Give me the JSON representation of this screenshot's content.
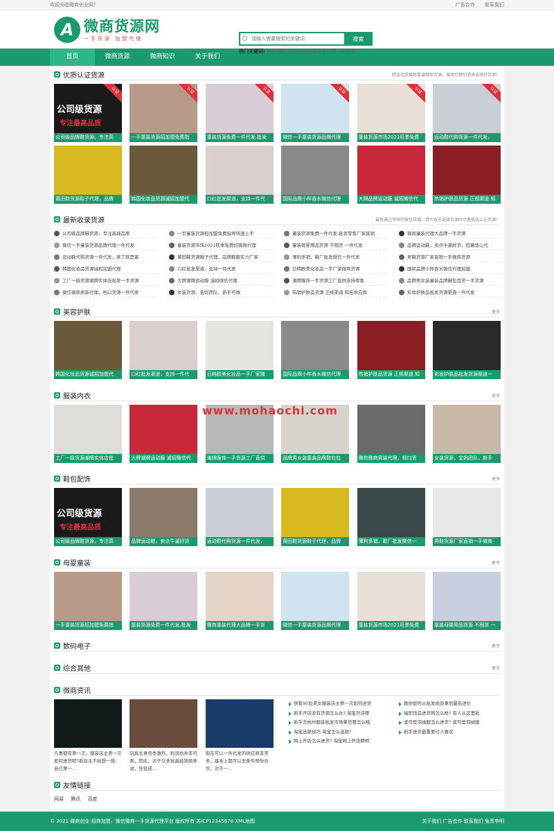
{
  "topbar": {
    "welcome": "欢迎光临微商创业网!",
    "ad": "广告合作",
    "contact": "联系我们"
  },
  "logo": {
    "mark": "A",
    "title": "微商货源网",
    "slogan": "一手货源 加盟代理"
  },
  "search": {
    "placeholder": "请输入需要搜索的关键词",
    "button": "搜索",
    "hot_label": "热门关键词:",
    "hot_words": "微商货源 淘宝网店免费微商代理一手货源"
  },
  "nav": [
    "首页",
    "微商货源",
    "微商知识",
    "关于我们"
  ],
  "watermark": "www.mohaochi.com",
  "sections": {
    "certified": {
      "title": "优质认证货源",
      "right": "精选优质推荐靠谱微商货源，微商代理们请来选择好货源！"
    },
    "latest": {
      "title": "最新收录货源",
      "right": "最新通过审核的微信货源，请大家在选择货源时尽量挑选认证货源！"
    },
    "beauty": {
      "title": "美容护肤",
      "right": "更多"
    },
    "clothes": {
      "title": "服装内衣",
      "right": "更多"
    },
    "shoes": {
      "title": "鞋包配饰",
      "right": "更多"
    },
    "baby": {
      "title": "母婴童装",
      "right": "更多"
    },
    "digital": {
      "title": "数码电子",
      "right": "更多"
    },
    "other": {
      "title": "综合其他",
      "right": "更多"
    },
    "news": {
      "title": "微商资讯"
    },
    "friends": {
      "title": "友情链接"
    }
  },
  "certified_cards": [
    {
      "cap": "公司级品牌鞋货源，专注高",
      "c": "#1a1a1a",
      "ribbon": "认证",
      "t1": "公司级货源",
      "t2": "专注最高品质"
    },
    {
      "cap": "一手童装货源招加盟免费指",
      "c": "#b89a8a",
      "ribbon": "认证"
    },
    {
      "cap": "童装货源免费一件代发,批发",
      "c": "#d8ccd6",
      "ribbon": "认证"
    },
    {
      "cap": "微信一手童装货源品牌代理",
      "c": "#cfe4ee",
      "ribbon": "认证"
    },
    {
      "cap": "童装货源市场2021旺季免费",
      "c": "#e8e0d6",
      "ribbon": "认证"
    },
    {
      "cap": "运动鞋代购货源一件代发，",
      "c": "#c9cfd4",
      "ribbon": "认证"
    },
    {
      "cap": "莆田鞋货源鞋子代理，品牌",
      "c": "#d9b920",
      "ribbon": ""
    },
    {
      "cap": "韩国化妆品货源诚招加盟代",
      "c": "#6b5a3a",
      "ribbon": ""
    },
    {
      "cap": "口红批发渠道，支持一件代",
      "c": "#d8d0cc",
      "ribbon": ""
    },
    {
      "cap": "国际品牌小样香水微信代理",
      "c": "#8a8a8a",
      "ribbon": ""
    },
    {
      "cap": "大牌品牌运动服 诚招微信代",
      "c": "#c8283a",
      "ribbon": ""
    },
    {
      "cap": "热销护肤品货源 正规渠道 知",
      "c": "#8a1e22",
      "ribbon": ""
    }
  ],
  "latest_list": [
    "公司级品牌鞋货源，专注高端品质",
    "一手童装货源招加盟免费指导快速上手",
    "童装货源免费一件代发,批发零售厂家直销",
    "微商童装代理大品牌一手货源",
    "微信一手童装货源品牌代理一件代发",
    "童装货源市场2021旺季免费招微商代理",
    "童装母婴用品货源 不囤货 一件代发",
    "品牌运动鞋，卖点牛逼好货，招募悠心代",
    "运动鞋代购货源一件代发，来了就是客",
    "莆田鞋货源鞋子代理，品牌鞋服实力厂家",
    "薄利多销，鞋厂批发微信一件代发",
    "男鞋货源厂家直销一手微商货源",
    "韩国化妆品货源诚招加盟代理",
    "口红批发渠道，支持一件代发",
    "日韩欧美化妆品一手厂家微商货源",
    "国际品牌小样香水微信代理加盟",
    "工厂一级货源潮牌实体店批发一手货源",
    "大牌潮牌运动服 诚招微信代理",
    "潮牌服饰一手货源工厂直供支持零售",
    "品牌男女装童装品牌鞋包百货一手货源",
    "微信微商男装代理，档口货源一件代发",
    "女装货源，宝妈团队，新手可做",
    "热销护肤品货源 正规渠道 知名供应商",
    "彩妆护肤品批发货源渠道一件代发"
  ],
  "beauty_cards": [
    {
      "cap": "韩国化妆品货源诚招加盟代",
      "c": "#6b5a3a"
    },
    {
      "cap": "口红批发渠道，支持一件代",
      "c": "#d8d0cc"
    },
    {
      "cap": "日韩欧美化妆品一手厂家微",
      "c": "#e8e4e0"
    },
    {
      "cap": "国际品牌小样香水微信代理",
      "c": "#8a8a8a"
    },
    {
      "cap": "热销护肤品货源 正规渠道 知",
      "c": "#8a1e22"
    },
    {
      "cap": "彩妆护肤品批发货源渠道一",
      "c": "#2a2a2a"
    }
  ],
  "clothes_cards": [
    {
      "cap": "工厂一级货源潮牌实体店批",
      "c": "#e0ddd8"
    },
    {
      "cap": "大牌潮牌运动服 诚招微信代",
      "c": "#c8283a"
    },
    {
      "cap": "潮牌服饰一手货源工厂直供",
      "c": "#b8b8b8"
    },
    {
      "cap": "品牌男女装童装品牌鞋包包",
      "c": "#d8d4cc"
    },
    {
      "cap": "微信微商男装代理，档口货",
      "c": "#6a6a6a"
    },
    {
      "cap": "女装货源，宝妈团队，新手",
      "c": "#c8b8a8"
    }
  ],
  "shoes_cards": [
    {
      "cap": "公司级品牌鞋货源，专注高",
      "c": "#1a1a1a",
      "t1": "公司级货源",
      "t2": "专注最高品质"
    },
    {
      "cap": "品牌运动鞋，卖点牛逼好货",
      "c": "#8a7a6a"
    },
    {
      "cap": "运动鞋代购货源一件代发，",
      "c": "#c9cfd4"
    },
    {
      "cap": "莆田鞋货源鞋子代理，品牌",
      "c": "#d9b920"
    },
    {
      "cap": "薄利多销，鞋厂批发微信一",
      "c": "#3a4a4a"
    },
    {
      "cap": "男鞋货源厂家直销一手微商",
      "c": "#e8e8ea"
    }
  ],
  "baby_cards": [
    {
      "cap": "一手童装货源招加盟免费指",
      "c": "#b89a8a"
    },
    {
      "cap": "童装货源免费一件代发,批发",
      "c": "#d8ccd6"
    },
    {
      "cap": "微商童装代理大品牌一手货",
      "c": "#e4d4c8"
    },
    {
      "cap": "微信一手童装货源品牌代理",
      "c": "#cfe4ee"
    },
    {
      "cap": "童装货源市场2021旺季免费",
      "c": "#e8e0d6"
    },
    {
      "cap": "童装母婴用品货源 不囤货 一",
      "c": "#c8d0e0"
    }
  ],
  "news": {
    "pics": [
      {
        "c": "#111a1a",
        "txt": "凡事都有第一次，服装店主第一次如何进货呢?新店主不妨想一想，自己第一..."
      },
      {
        "c": "#6a4a3a",
        "txt": "玩具生意竞争激烈，利润也并非可观，因此，对于众多玩具经销商来说，压低成..."
      },
      {
        "c": "#1a3a6a",
        "txt": "现在可以一件代发的供应商非常多，基本上都可以无条件帮你合作，对于一..."
      }
    ],
    "col1": [
      "快看90后美女服装店主第一次如何进货",
      "新手开店没有货源怎么办? 淘宝开店哪",
      "新手去杭州服装批发市场拿货要怎么喊",
      "淘宝选款技巧 淘宝怎么选款?",
      "网上开店怎么进货? 淘宝网上开店精明"
    ],
    "col2": [
      "教你如何从批发商处拿到最低进价",
      "福田饰品进货网怎么样? 有人从这里批",
      "波司登羽绒服怎么进货? 波司登羽绒服",
      "新手进货最重要讨人喜欢"
    ]
  },
  "friends": [
    "网易",
    "腾讯",
    "百度"
  ],
  "footer": {
    "left": "© 2021 微商创业-招商加盟、微信微商一手货源代理平台 版权所有 苏ICP12345678 XML地图",
    "right": "关于我们 广告合作 联系我们 免责申明"
  }
}
